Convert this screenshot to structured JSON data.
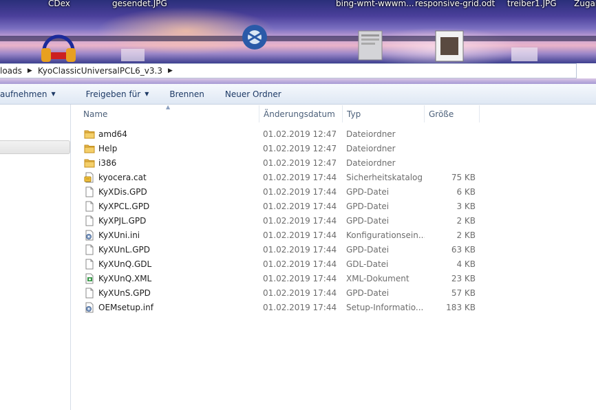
{
  "desktop": {
    "labels": [
      "CDex",
      "gesendet.JPG",
      "bing-wmt-wwwm...",
      "responsive-grid.odt",
      "treiber1.JPG",
      "Zugan"
    ]
  },
  "address": {
    "crumbs": [
      "loads",
      "KyoClassicUniversalPCL6_v3.3"
    ]
  },
  "toolbar": {
    "include_label": "aufnehmen",
    "share_label": "Freigeben für",
    "burn_label": "Brennen",
    "new_folder_label": "Neuer Ordner"
  },
  "columns": {
    "name": "Name",
    "date": "Änderungsdatum",
    "type": "Typ",
    "size": "Größe"
  },
  "files": [
    {
      "name": "amd64",
      "date": "01.02.2019 12:47",
      "type": "Dateiordner",
      "size": "",
      "icon": "folder-icon"
    },
    {
      "name": "Help",
      "date": "01.02.2019 12:47",
      "type": "Dateiordner",
      "size": "",
      "icon": "folder-icon"
    },
    {
      "name": "i386",
      "date": "01.02.2019 12:47",
      "type": "Dateiordner",
      "size": "",
      "icon": "folder-icon"
    },
    {
      "name": "kyocera.cat",
      "date": "01.02.2019 17:44",
      "type": "Sicherheitskatalog",
      "size": "75 KB",
      "icon": "catalog-icon"
    },
    {
      "name": "KyXDis.GPD",
      "date": "01.02.2019 17:44",
      "type": "GPD-Datei",
      "size": "6 KB",
      "icon": "file-icon"
    },
    {
      "name": "KyXPCL.GPD",
      "date": "01.02.2019 17:44",
      "type": "GPD-Datei",
      "size": "3 KB",
      "icon": "file-icon"
    },
    {
      "name": "KyXPJL.GPD",
      "date": "01.02.2019 17:44",
      "type": "GPD-Datei",
      "size": "2 KB",
      "icon": "file-icon"
    },
    {
      "name": "KyXUni.ini",
      "date": "01.02.2019 17:44",
      "type": "Konfigurationsein...",
      "size": "2 KB",
      "icon": "settings-file-icon"
    },
    {
      "name": "KyXUnL.GPD",
      "date": "01.02.2019 17:44",
      "type": "GPD-Datei",
      "size": "63 KB",
      "icon": "file-icon"
    },
    {
      "name": "KyXUnQ.GDL",
      "date": "01.02.2019 17:44",
      "type": "GDL-Datei",
      "size": "4 KB",
      "icon": "file-icon"
    },
    {
      "name": "KyXUnQ.XML",
      "date": "01.02.2019 17:44",
      "type": "XML-Dokument",
      "size": "23 KB",
      "icon": "xml-file-icon"
    },
    {
      "name": "KyXUnS.GPD",
      "date": "01.02.2019 17:44",
      "type": "GPD-Datei",
      "size": "57 KB",
      "icon": "file-icon"
    },
    {
      "name": "OEMsetup.inf",
      "date": "01.02.2019 17:44",
      "type": "Setup-Informatio...",
      "size": "183 KB",
      "icon": "settings-file-icon"
    }
  ]
}
